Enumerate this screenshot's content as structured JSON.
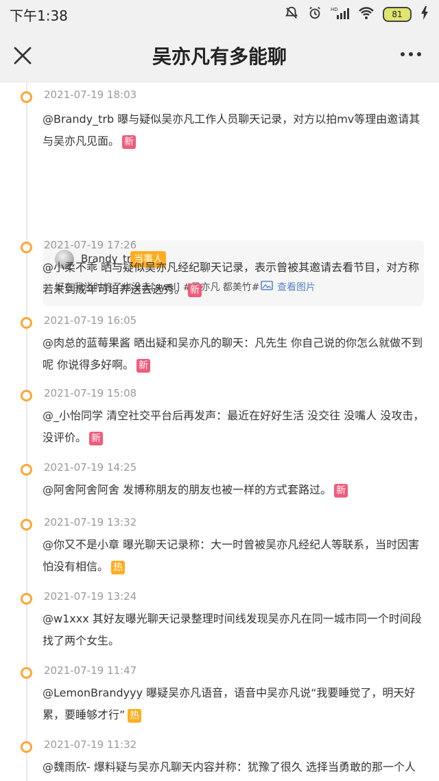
{
  "status_bar": {
    "time": "下午1:38",
    "network_label": "HD",
    "battery": "81"
  },
  "header": {
    "title": "吴亦凡有多能聊",
    "close_icon": "close-icon",
    "more_icon": "more-icon"
  },
  "timeline": [
    {
      "timestamp": "2021-07-19 18:03",
      "text": "@Brandy_trb 曝与疑似吴亦凡工作人员聊天记录，对方以拍mv等理由邀请其与吴亦凡见面。",
      "tag": "新"
    },
    {
      "timestamp": "2021-07-19 17:26",
      "text": "@小柔不乖 晒与疑似吴亦凡经纪聊天记录，表示曾被其邀请去看节目，对方称若未到成年可培养送去选秀。",
      "tag": "新"
    },
    {
      "timestamp": "2021-07-19 16:05",
      "text": "@肉总的蓝莓果酱 晒出疑和吴亦凡的聊天：凡先生 你自己说的你怎么就做不到呢 你说得多好啊。",
      "tag": "新"
    },
    {
      "timestamp": "2021-07-19 15:08",
      "text": "@_小怡同学 清空社交平台后再发声：最近在好好生活 没交往 没嘴人 没攻击，没评价。",
      "tag": "新"
    },
    {
      "timestamp": "2021-07-19 14:25",
      "text": "@阿舍阿舍阿舍 发博称朋友的朋友也被一样的方式套路过。",
      "tag": "新"
    },
    {
      "timestamp": "2021-07-19 13:32",
      "text": "@你又不是小章 曝光聊天记录称：大一时曾被吴亦凡经纪人等联系，当时因害怕没有相信。",
      "tag": "热"
    },
    {
      "timestamp": "2021-07-19 13:24",
      "text": "@w1xxx 其好友曝光聊天记录整理时间线发现吴亦凡在同一城市同一个时间段找了两个女生。",
      "tag": ""
    },
    {
      "timestamp": "2021-07-19 11:47",
      "text": "@LemonBrandyyy 曝疑吴亦凡语音，语音中吴亦凡说“我要睡觉了，明天好累，要睡够才行”",
      "tag": "热"
    },
    {
      "timestamp": "2021-07-19 11:32",
      "text": "@魏雨欣- 爆料疑与吴亦凡聊天内容并称：犹豫了很久 选择当勇敢的那一个人 。",
      "tag": "热"
    }
  ],
  "quote": {
    "username": "Brandy_trb",
    "role": "当事人",
    "content": "好在我当时信了也没去[awsl] #吴亦凡 都美竹#",
    "view_image": "查看图片"
  }
}
